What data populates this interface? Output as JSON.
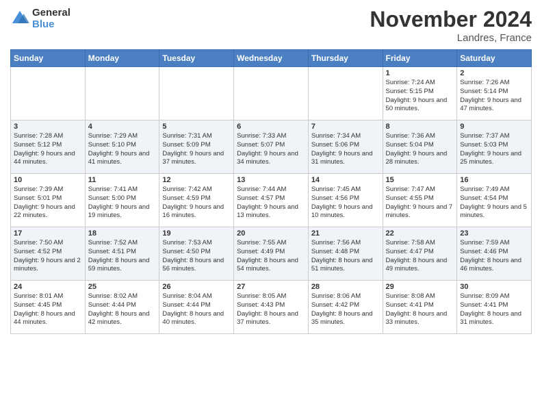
{
  "logo": {
    "line1": "General",
    "line2": "Blue"
  },
  "title": "November 2024",
  "location": "Landres, France",
  "days_of_week": [
    "Sunday",
    "Monday",
    "Tuesday",
    "Wednesday",
    "Thursday",
    "Friday",
    "Saturday"
  ],
  "weeks": [
    [
      {
        "day": "",
        "info": ""
      },
      {
        "day": "",
        "info": ""
      },
      {
        "day": "",
        "info": ""
      },
      {
        "day": "",
        "info": ""
      },
      {
        "day": "",
        "info": ""
      },
      {
        "day": "1",
        "info": "Sunrise: 7:24 AM\nSunset: 5:15 PM\nDaylight: 9 hours and 50 minutes."
      },
      {
        "day": "2",
        "info": "Sunrise: 7:26 AM\nSunset: 5:14 PM\nDaylight: 9 hours and 47 minutes."
      }
    ],
    [
      {
        "day": "3",
        "info": "Sunrise: 7:28 AM\nSunset: 5:12 PM\nDaylight: 9 hours and 44 minutes."
      },
      {
        "day": "4",
        "info": "Sunrise: 7:29 AM\nSunset: 5:10 PM\nDaylight: 9 hours and 41 minutes."
      },
      {
        "day": "5",
        "info": "Sunrise: 7:31 AM\nSunset: 5:09 PM\nDaylight: 9 hours and 37 minutes."
      },
      {
        "day": "6",
        "info": "Sunrise: 7:33 AM\nSunset: 5:07 PM\nDaylight: 9 hours and 34 minutes."
      },
      {
        "day": "7",
        "info": "Sunrise: 7:34 AM\nSunset: 5:06 PM\nDaylight: 9 hours and 31 minutes."
      },
      {
        "day": "8",
        "info": "Sunrise: 7:36 AM\nSunset: 5:04 PM\nDaylight: 9 hours and 28 minutes."
      },
      {
        "day": "9",
        "info": "Sunrise: 7:37 AM\nSunset: 5:03 PM\nDaylight: 9 hours and 25 minutes."
      }
    ],
    [
      {
        "day": "10",
        "info": "Sunrise: 7:39 AM\nSunset: 5:01 PM\nDaylight: 9 hours and 22 minutes."
      },
      {
        "day": "11",
        "info": "Sunrise: 7:41 AM\nSunset: 5:00 PM\nDaylight: 9 hours and 19 minutes."
      },
      {
        "day": "12",
        "info": "Sunrise: 7:42 AM\nSunset: 4:59 PM\nDaylight: 9 hours and 16 minutes."
      },
      {
        "day": "13",
        "info": "Sunrise: 7:44 AM\nSunset: 4:57 PM\nDaylight: 9 hours and 13 minutes."
      },
      {
        "day": "14",
        "info": "Sunrise: 7:45 AM\nSunset: 4:56 PM\nDaylight: 9 hours and 10 minutes."
      },
      {
        "day": "15",
        "info": "Sunrise: 7:47 AM\nSunset: 4:55 PM\nDaylight: 9 hours and 7 minutes."
      },
      {
        "day": "16",
        "info": "Sunrise: 7:49 AM\nSunset: 4:54 PM\nDaylight: 9 hours and 5 minutes."
      }
    ],
    [
      {
        "day": "17",
        "info": "Sunrise: 7:50 AM\nSunset: 4:52 PM\nDaylight: 9 hours and 2 minutes."
      },
      {
        "day": "18",
        "info": "Sunrise: 7:52 AM\nSunset: 4:51 PM\nDaylight: 8 hours and 59 minutes."
      },
      {
        "day": "19",
        "info": "Sunrise: 7:53 AM\nSunset: 4:50 PM\nDaylight: 8 hours and 56 minutes."
      },
      {
        "day": "20",
        "info": "Sunrise: 7:55 AM\nSunset: 4:49 PM\nDaylight: 8 hours and 54 minutes."
      },
      {
        "day": "21",
        "info": "Sunrise: 7:56 AM\nSunset: 4:48 PM\nDaylight: 8 hours and 51 minutes."
      },
      {
        "day": "22",
        "info": "Sunrise: 7:58 AM\nSunset: 4:47 PM\nDaylight: 8 hours and 49 minutes."
      },
      {
        "day": "23",
        "info": "Sunrise: 7:59 AM\nSunset: 4:46 PM\nDaylight: 8 hours and 46 minutes."
      }
    ],
    [
      {
        "day": "24",
        "info": "Sunrise: 8:01 AM\nSunset: 4:45 PM\nDaylight: 8 hours and 44 minutes."
      },
      {
        "day": "25",
        "info": "Sunrise: 8:02 AM\nSunset: 4:44 PM\nDaylight: 8 hours and 42 minutes."
      },
      {
        "day": "26",
        "info": "Sunrise: 8:04 AM\nSunset: 4:44 PM\nDaylight: 8 hours and 40 minutes."
      },
      {
        "day": "27",
        "info": "Sunrise: 8:05 AM\nSunset: 4:43 PM\nDaylight: 8 hours and 37 minutes."
      },
      {
        "day": "28",
        "info": "Sunrise: 8:06 AM\nSunset: 4:42 PM\nDaylight: 8 hours and 35 minutes."
      },
      {
        "day": "29",
        "info": "Sunrise: 8:08 AM\nSunset: 4:41 PM\nDaylight: 8 hours and 33 minutes."
      },
      {
        "day": "30",
        "info": "Sunrise: 8:09 AM\nSunset: 4:41 PM\nDaylight: 8 hours and 31 minutes."
      }
    ]
  ]
}
